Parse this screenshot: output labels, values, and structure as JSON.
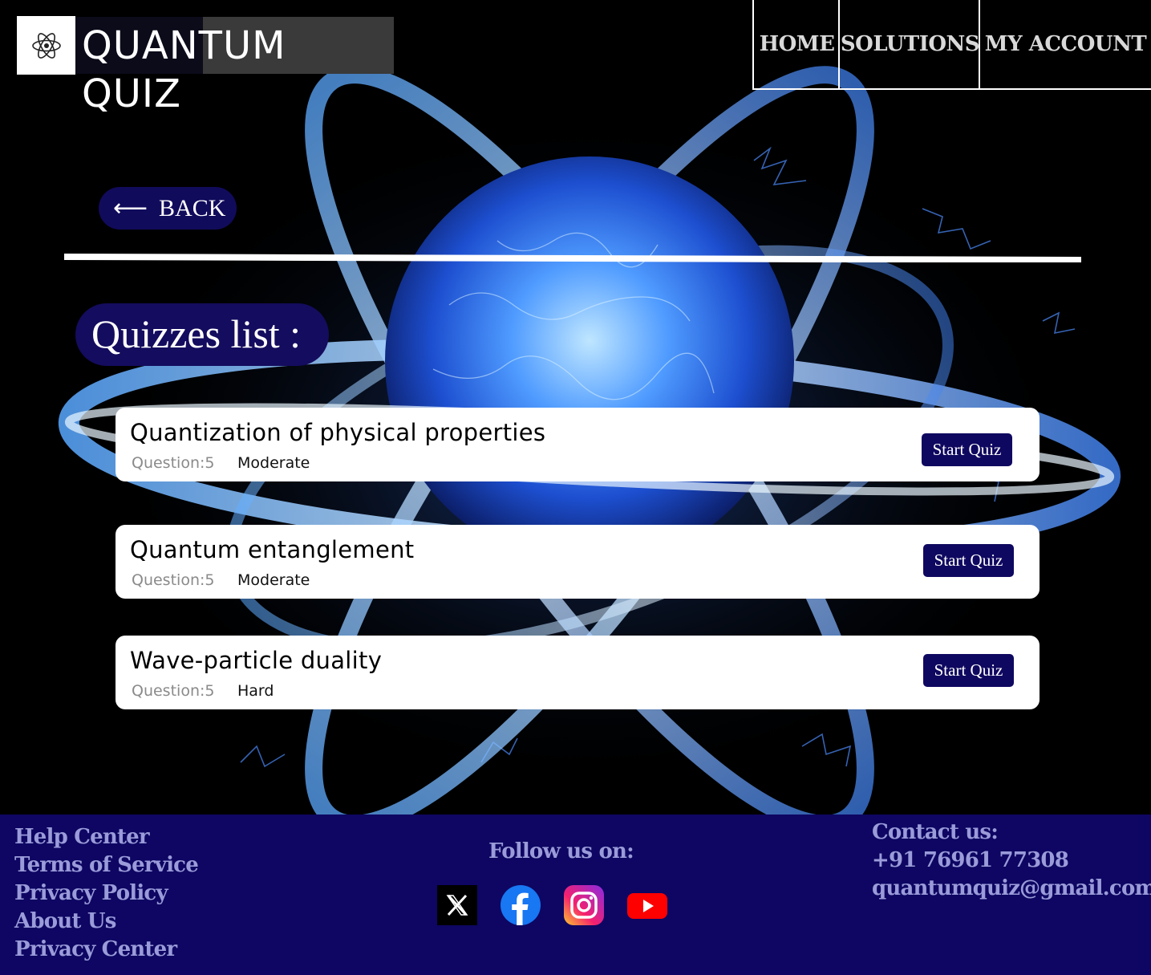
{
  "header": {
    "title": "QUANTUM QUIZ",
    "logo_icon": "atom-icon",
    "nav": [
      "HOME",
      "SOLUTIONS",
      "MY ACCOUNT"
    ]
  },
  "back": {
    "arrow": "⟵",
    "label": "BACK"
  },
  "list_title": "Quizzes list :",
  "quizzes": [
    {
      "name": "Quantization of physical properties",
      "questions": "Question:5",
      "level": "Moderate",
      "button": "Start Quiz"
    },
    {
      "name": "Quantum entanglement",
      "questions": "Question:5",
      "level": "Moderate",
      "button": "Start Quiz"
    },
    {
      "name": "Wave-particle duality",
      "questions": "Question:5",
      "level": "Hard",
      "button": "Start Quiz"
    }
  ],
  "footer": {
    "links": [
      "Help Center",
      "Terms of Service",
      "Privacy Policy",
      "About Us",
      "Privacy Center"
    ],
    "follow": "Follow us on:",
    "social_icons": [
      "x-icon",
      "facebook-icon",
      "instagram-icon",
      "youtube-icon"
    ],
    "contact_title": "Contact us:",
    "phone": "+91 76961 77308",
    "email": "quantumquiz@gmail.com"
  },
  "colors": {
    "accent": "#110b5c",
    "footer_bg": "#0e0662",
    "footer_text": "#9a9bd9"
  }
}
